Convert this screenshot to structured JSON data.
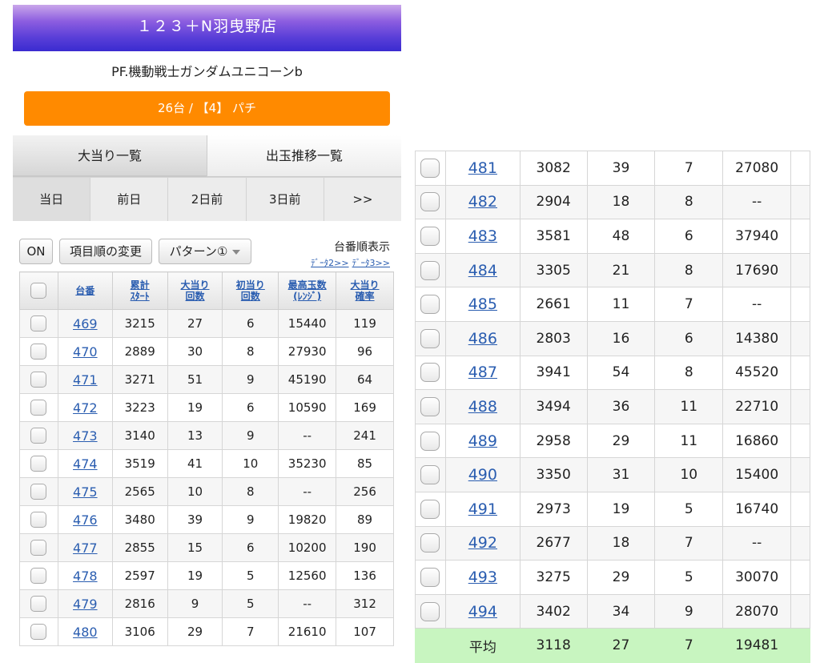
{
  "header": {
    "store": "１２３＋N羽曳野店",
    "model": "PF.機動戦士ガンダムユニコーンb",
    "count_button": "26台 / 【4】 パチ"
  },
  "tabs": [
    "大当り一覧",
    "出玉推移一覧"
  ],
  "days": [
    "当日",
    "前日",
    "2日前",
    "3日前",
    ">>"
  ],
  "toolbar": {
    "on": "ON",
    "order_change": "項目順の変更",
    "pattern": "パターン①",
    "sort_label": "台番順表示",
    "data2": "ﾃﾞｰﾀ2>>",
    "data3": "ﾃﾞｰﾀ3>>"
  },
  "columns": [
    {
      "l1": "台番",
      "l2": ""
    },
    {
      "l1": "累計",
      "l2": "ｽﾀｰﾄ"
    },
    {
      "l1": "大当り",
      "l2": "回数"
    },
    {
      "l1": "初当り",
      "l2": "回数"
    },
    {
      "l1": "最高玉数",
      "l2": "(ﾚﾝｼﾞ)"
    },
    {
      "l1": "大当り",
      "l2": "確率"
    }
  ],
  "left_rows": [
    [
      "469",
      "3215",
      "27",
      "6",
      "15440",
      "119"
    ],
    [
      "470",
      "2889",
      "30",
      "8",
      "27930",
      "96"
    ],
    [
      "471",
      "3271",
      "51",
      "9",
      "45190",
      "64"
    ],
    [
      "472",
      "3223",
      "19",
      "6",
      "10590",
      "169"
    ],
    [
      "473",
      "3140",
      "13",
      "9",
      "--",
      "241"
    ],
    [
      "474",
      "3519",
      "41",
      "10",
      "35230",
      "85"
    ],
    [
      "475",
      "2565",
      "10",
      "8",
      "--",
      "256"
    ],
    [
      "476",
      "3480",
      "39",
      "9",
      "19820",
      "89"
    ],
    [
      "477",
      "2855",
      "15",
      "6",
      "10200",
      "190"
    ],
    [
      "478",
      "2597",
      "19",
      "5",
      "12560",
      "136"
    ],
    [
      "479",
      "2816",
      "9",
      "5",
      "--",
      "312"
    ],
    [
      "480",
      "3106",
      "29",
      "7",
      "21610",
      "107"
    ]
  ],
  "right_rows": [
    [
      "481",
      "3082",
      "39",
      "7",
      "27080"
    ],
    [
      "482",
      "2904",
      "18",
      "8",
      "--"
    ],
    [
      "483",
      "3581",
      "48",
      "6",
      "37940"
    ],
    [
      "484",
      "3305",
      "21",
      "8",
      "17690"
    ],
    [
      "485",
      "2661",
      "11",
      "7",
      "--"
    ],
    [
      "486",
      "2803",
      "16",
      "6",
      "14380"
    ],
    [
      "487",
      "3941",
      "54",
      "8",
      "45520"
    ],
    [
      "488",
      "3494",
      "36",
      "11",
      "22710"
    ],
    [
      "489",
      "2958",
      "29",
      "11",
      "16860"
    ],
    [
      "490",
      "3350",
      "31",
      "10",
      "15400"
    ],
    [
      "491",
      "2973",
      "19",
      "5",
      "16740"
    ],
    [
      "492",
      "2677",
      "18",
      "7",
      "--"
    ],
    [
      "493",
      "3275",
      "29",
      "5",
      "30070"
    ],
    [
      "494",
      "3402",
      "34",
      "9",
      "28070"
    ]
  ],
  "average": {
    "label": "平均",
    "values": [
      "3118",
      "27",
      "7",
      "19481"
    ]
  }
}
